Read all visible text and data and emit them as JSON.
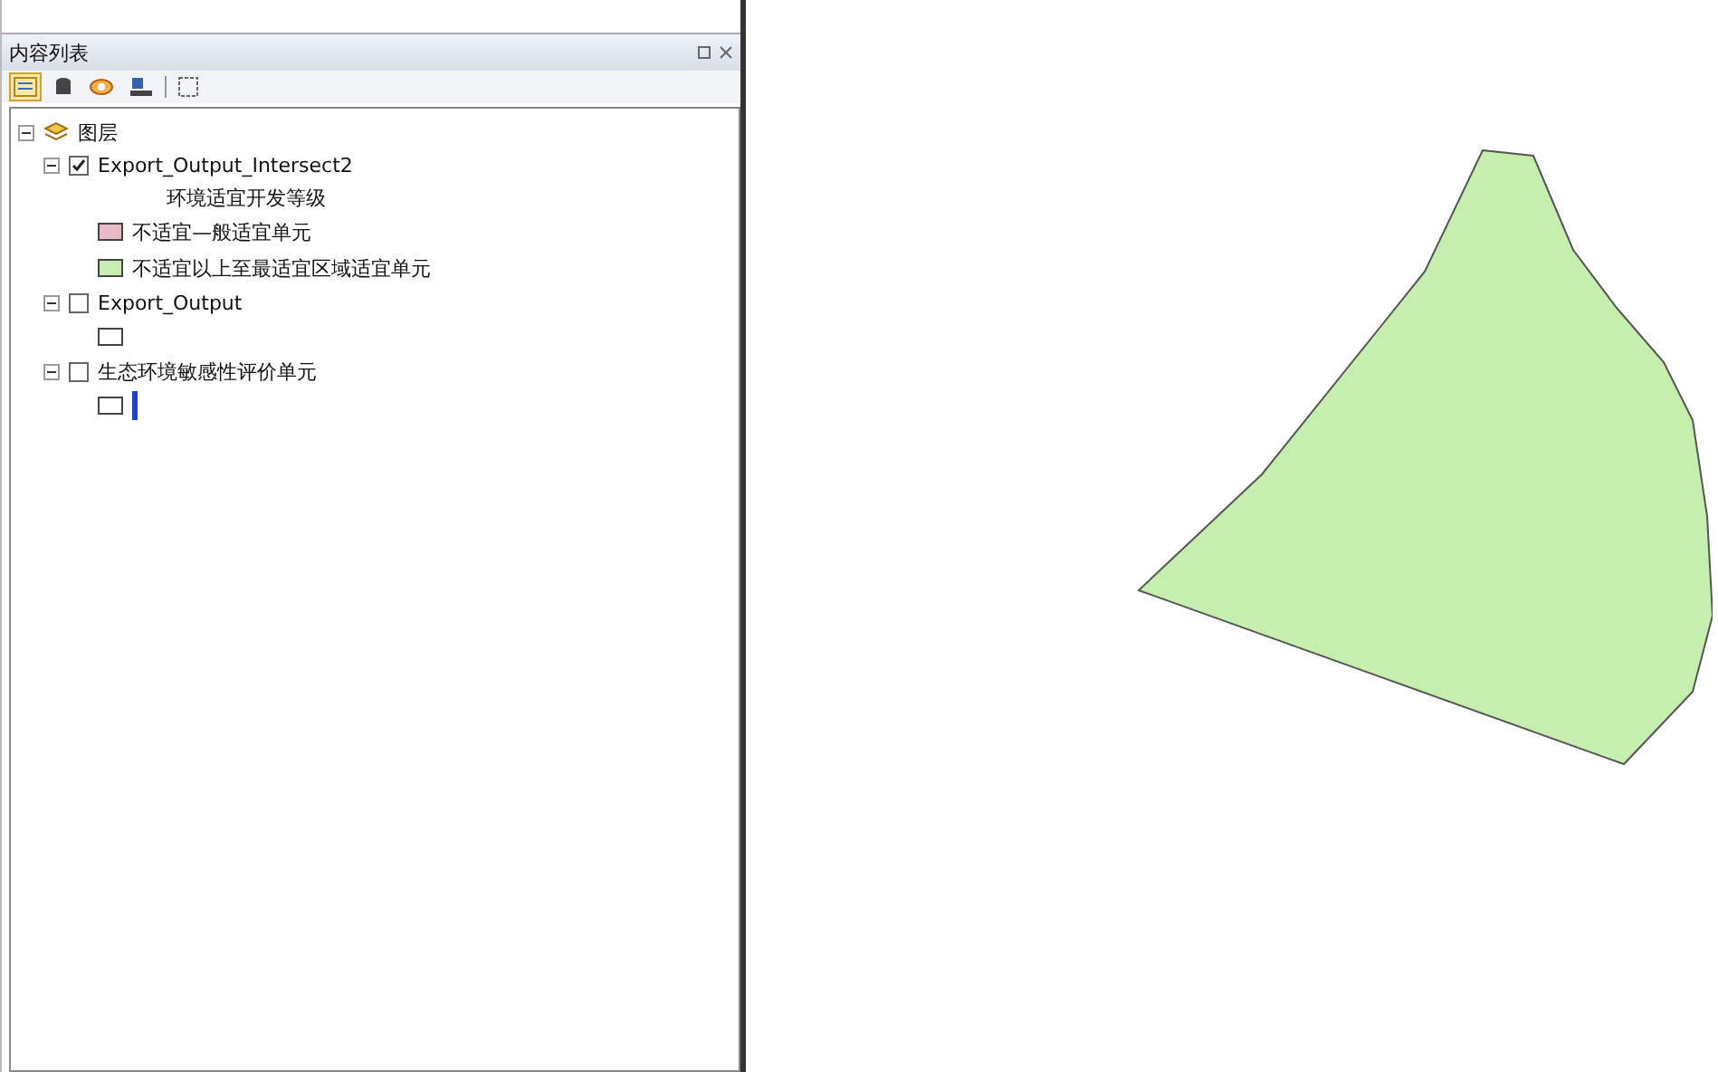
{
  "panel": {
    "title": "内容列表"
  },
  "toolbar": [
    {
      "kind": "list",
      "selected": true
    },
    {
      "kind": "source",
      "selected": false
    },
    {
      "kind": "visibility",
      "selected": false
    },
    {
      "kind": "selection",
      "selected": false
    },
    {
      "kind": "options",
      "selected": false
    }
  ],
  "tree": {
    "label": "图层",
    "expanded": true,
    "children": [
      {
        "label": "Export_Output_Intersect2",
        "checked": true,
        "expanded": true,
        "heading": "环境适宜开发等级",
        "legend": [
          {
            "label": "不适宜—般适宜单元",
            "color": "#e9b9c6"
          },
          {
            "label": "不适宜以上至最适宜区域适宜单元",
            "color": "#c8ecb4"
          }
        ]
      },
      {
        "label": "Export_Output",
        "checked": false,
        "expanded": true,
        "legend": [
          {
            "color": "#ffffff",
            "editing": false
          }
        ]
      },
      {
        "label": "生态环境敏感性评价单元",
        "checked": false,
        "expanded": true,
        "legend": [
          {
            "color": "#ffffff",
            "editing": true
          }
        ]
      }
    ]
  },
  "map": {
    "polygon": {
      "color": "#c6eeae"
    }
  }
}
